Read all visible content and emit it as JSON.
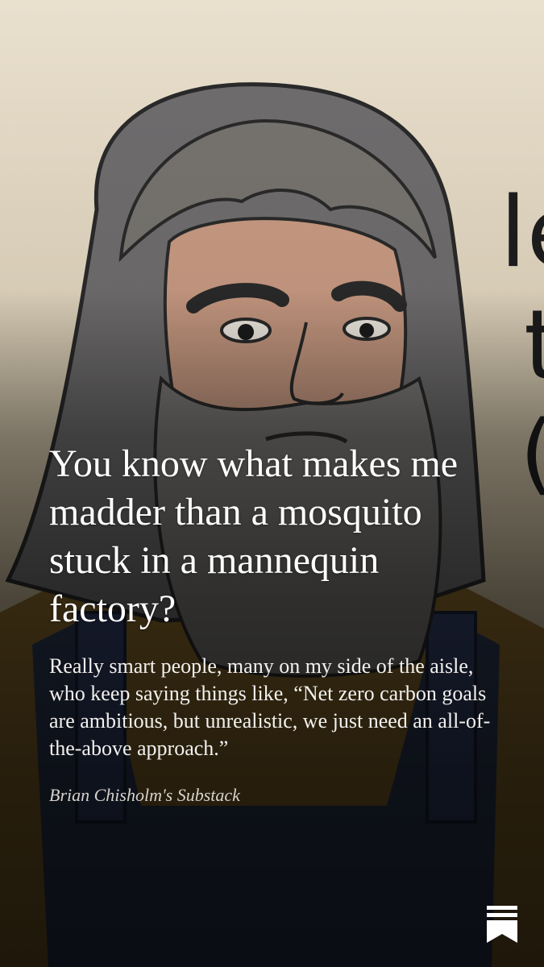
{
  "post": {
    "headline": "You know what makes me madder than a mosquito stuck in a mannequin factory?",
    "excerpt": "Really smart people, many on my side of the aisle, who keep saying things like, “Net zero carbon goals are ambitious, but unrealistic, we just need an all-of-the-above approach.”",
    "publication": "Brian Chisholm's Substack"
  },
  "illustration": {
    "subject": "cartoon man with long gray hair and beard wearing overalls",
    "partial_text": [
      "le",
      "t",
      "("
    ]
  },
  "icons": {
    "logo": "substack-bookmark-icon"
  },
  "colors": {
    "background": "#e2d6bf",
    "hair": "#6f6d6e",
    "skin": "#c89a82",
    "overalls": "#2e3a55",
    "shirt": "#8b6a2c",
    "text": "#ffffff"
  }
}
